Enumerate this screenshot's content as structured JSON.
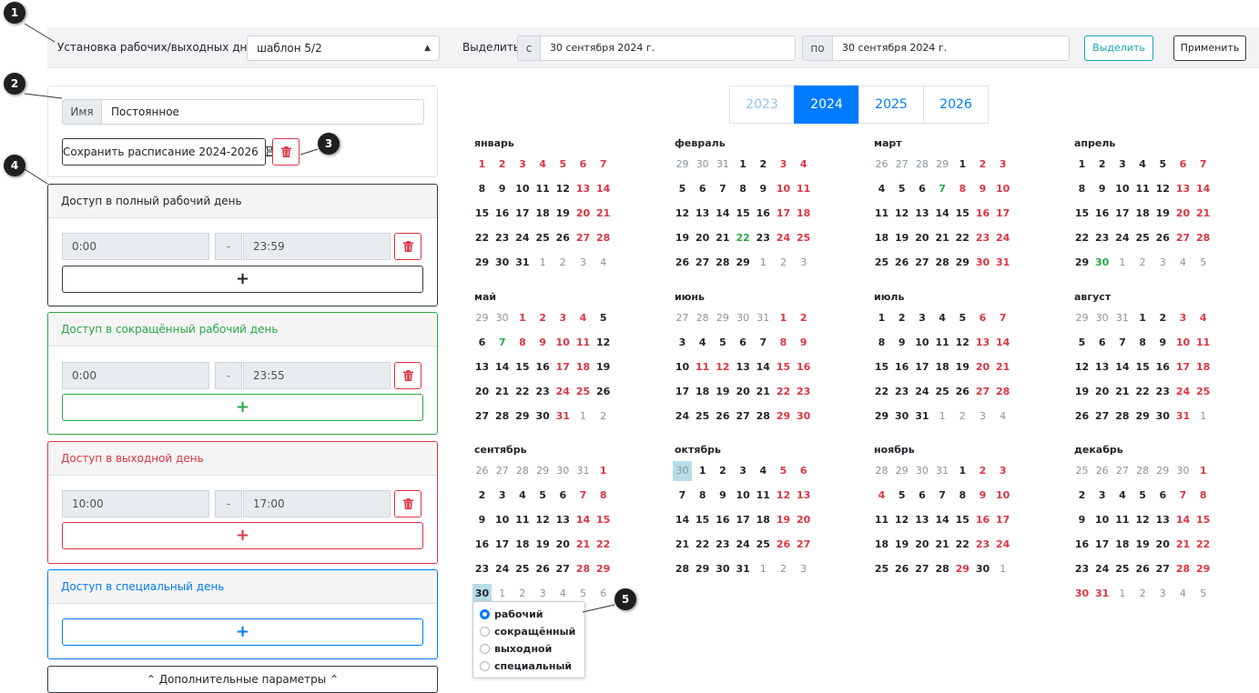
{
  "toolbar": {
    "workdays_label": "Установка рабочих/выходных дней",
    "template_value": "шаблон 5/2",
    "select_label": "Выделить",
    "from_addon": "с",
    "from_value": "30 сентября 2024 г.",
    "to_addon": "по",
    "to_value": "30 сентября 2024 г.",
    "select_button": "Выделить",
    "apply_button": "Применить"
  },
  "markers": [
    "1",
    "2",
    "3",
    "4",
    "5"
  ],
  "schedule": {
    "name_addon": "Имя",
    "name_value": "Постоянное",
    "save_button": "Сохранить расписание 2024-2026"
  },
  "sections": [
    {
      "title": "Доступ в полный рабочий день",
      "color": "#212529",
      "border": "#343a40",
      "from": "0:00",
      "dash": "-",
      "to": "23:59",
      "plus": "+"
    },
    {
      "title": "Доступ в сокращённый рабочий день",
      "color": "#28a745",
      "border": "#28a745",
      "from": "0:00",
      "dash": "-",
      "to": "23:55",
      "plus": "+"
    },
    {
      "title": "Доступ в выходной день",
      "color": "#dc3545",
      "border": "#dc3545",
      "from": "10:00",
      "dash": "-",
      "to": "17:00",
      "plus": "+"
    },
    {
      "title": "Доступ в специальный день",
      "color": "#007bff",
      "border": "#007bff",
      "plus": "+"
    }
  ],
  "extra_button": "Дополнительные параметры",
  "years": [
    {
      "label": "2023",
      "state": "dim"
    },
    {
      "label": "2024",
      "state": "active"
    },
    {
      "label": "2025",
      "state": "normal"
    },
    {
      "label": "2026",
      "state": "normal"
    }
  ],
  "months": [
    {
      "name": "январь",
      "lead": [],
      "days": "hhhhhhhwwwwwhhwwwwwhhwwwwwhhwww",
      "trail": [
        "1",
        "2",
        "3",
        "4"
      ]
    },
    {
      "name": "февраль",
      "lead": [
        "29",
        "30",
        "31"
      ],
      "days": "wwhhwwwwwhhwwwwwhhwwwswhhwwww",
      "trail": [
        "1",
        "2",
        "3"
      ]
    },
    {
      "name": "март",
      "lead": [
        "26",
        "27",
        "28",
        "29"
      ],
      "days": "whhwwwshhhwwwwwhhwwwwwhhwwwwwhh",
      "trail": []
    },
    {
      "name": "апрель",
      "lead": [],
      "days": "wwwwwhhwwwwwhhwwwwwhhwwwwwhhws",
      "trail": [
        "1",
        "2",
        "3",
        "4",
        "5"
      ]
    },
    {
      "name": "май",
      "lead": [
        "29",
        "30"
      ],
      "days": "hhhhwwshhhhwwwwwhhwwwwwhhwwwwwh",
      "trail": [
        "1",
        "2"
      ]
    },
    {
      "name": "июнь",
      "lead": [
        "27",
        "28",
        "29",
        "30",
        "31"
      ],
      "days": "hhwwwwwhhwhhwwhhwwwwwhhwwwwwhh",
      "trail": []
    },
    {
      "name": "июль",
      "lead": [],
      "days": "wwwwwhhwwwwwhhwwwwwhhwwwwwhhwww",
      "trail": [
        "1",
        "2",
        "3",
        "4"
      ]
    },
    {
      "name": "август",
      "lead": [
        "29",
        "30",
        "31"
      ],
      "days": "wwhhwwwwwhhwwwwwhhwwwwwhhwwwwwh",
      "trail": [
        "1"
      ]
    },
    {
      "name": "сентябрь",
      "lead": [
        "26",
        "27",
        "28",
        "29",
        "30",
        "31"
      ],
      "days": "hwwwwwhhwwwwwhhwwwwwhhwwwwwhhw",
      "selected_day": 30,
      "trail": [
        "1",
        "2",
        "3",
        "4",
        "5",
        "6"
      ]
    },
    {
      "name": "октябрь",
      "lead": [
        "30"
      ],
      "selected_lead": 0,
      "days": "wwwwhhwwwwwhhwwwwwhhwwwwwhhwwww",
      "trail": [
        "1",
        "2",
        "3"
      ]
    },
    {
      "name": "ноябрь",
      "lead": [
        "28",
        "29",
        "30",
        "31"
      ],
      "days": "whhhwwwwhhwwwwwhhwwwwwhhwwwwhw",
      "trail": [
        "1"
      ]
    },
    {
      "name": "декабрь",
      "lead": [
        "25",
        "26",
        "27",
        "28",
        "29",
        "30"
      ],
      "days": "hwwwwwhhwwwwwhhwwwwwhhwwwwwhhhh",
      "trail": [
        "1",
        "2",
        "3",
        "4",
        "5"
      ]
    }
  ],
  "day_popup": {
    "options": [
      "рабочий",
      "сокращённый",
      "выходной",
      "специальный"
    ],
    "selected": "рабочий"
  },
  "colors": {
    "workday": "#212529",
    "holiday": "#dc3545",
    "short_day": "#28a745",
    "other_month": "#8a939b",
    "selected_bg": "#b8dde8",
    "accent": "#007bff"
  }
}
